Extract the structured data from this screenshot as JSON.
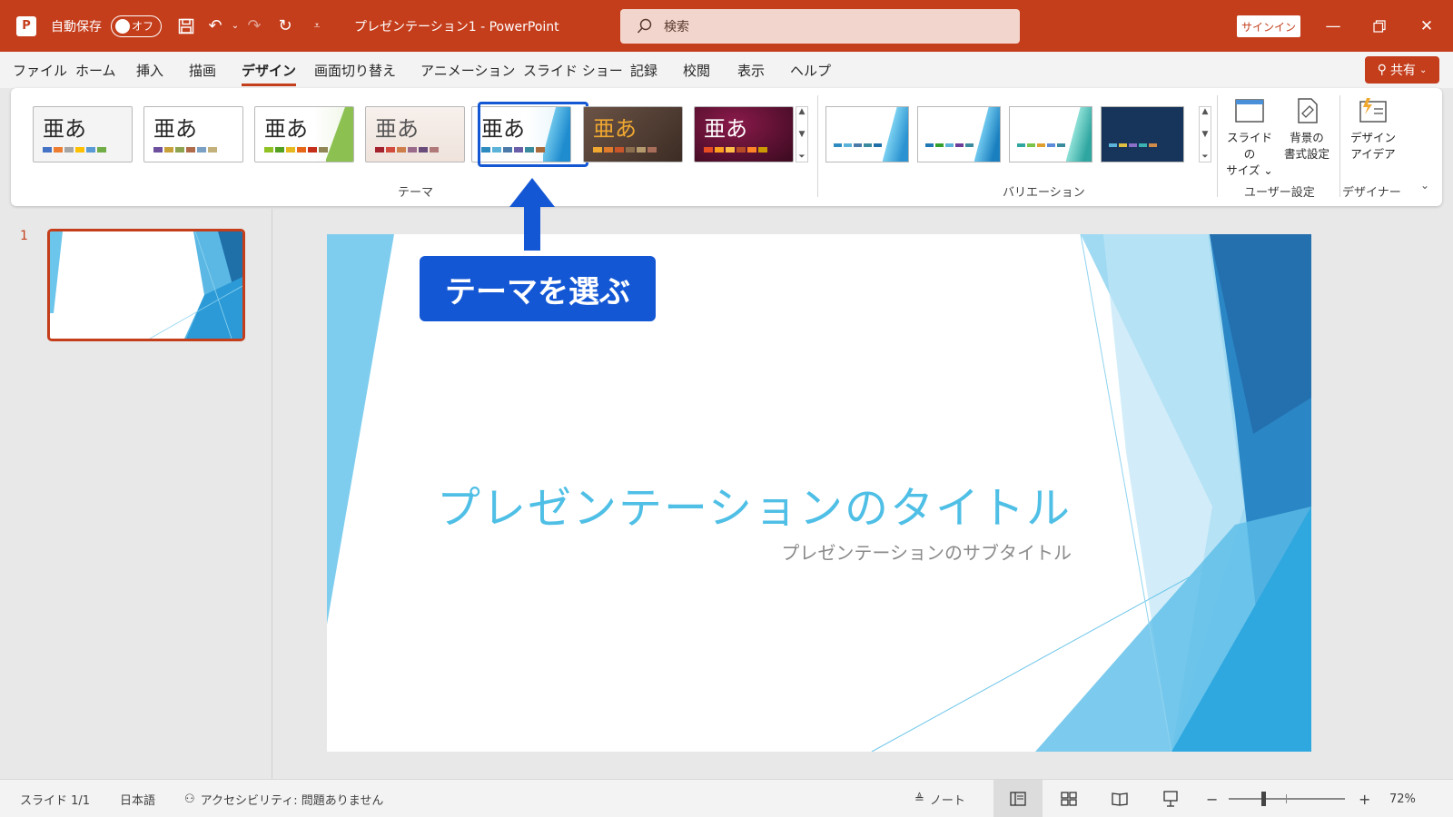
{
  "titlebar": {
    "autosave_label": "自動保存",
    "toggle_state": "オフ",
    "doc_title": "プレゼンテーション1 - PowerPoint",
    "search_placeholder": "検索",
    "signin": "サインイン"
  },
  "menu": {
    "tabs": [
      {
        "label": "ファイル"
      },
      {
        "label": "ホーム"
      },
      {
        "label": "挿入"
      },
      {
        "label": "描画"
      },
      {
        "label": "デザイン",
        "active": true
      },
      {
        "label": "画面切り替え"
      },
      {
        "label": "アニメーション"
      },
      {
        "label": "スライド ショー"
      },
      {
        "label": "記録"
      },
      {
        "label": "校閲"
      },
      {
        "label": "表示"
      },
      {
        "label": "ヘルプ"
      }
    ],
    "share": "共有"
  },
  "ribbon": {
    "theme_label_text": "亜あ",
    "themes_group": "テーマ",
    "variations_group": "バリエーション",
    "custom_group": "ユーザー設定",
    "designer_group": "デザイナー",
    "slide_size": {
      "line1": "スライドの",
      "line2": "サイズ ⌄"
    },
    "format_bg": {
      "line1": "背景の",
      "line2": "書式設定"
    },
    "design_ideas": {
      "line1": "デザイン",
      "line2": "アイデア"
    }
  },
  "slides_panel": {
    "slide_number": "1"
  },
  "slide": {
    "title": "プレゼンテーションのタイトル",
    "subtitle": "プレゼンテーションのサブタイトル"
  },
  "callout": {
    "text": "テーマを選ぶ"
  },
  "statusbar": {
    "slide_info": "スライド 1/1",
    "language": "日本語",
    "accessibility": "アクセシビリティ: 問題ありません",
    "notes": "ノート",
    "zoom_level": "72%",
    "zoom_fraction": 0.3
  },
  "colors": {
    "accent": "#c43e1c",
    "callout": "#1457d4",
    "title_text": "#4fbfe6"
  }
}
